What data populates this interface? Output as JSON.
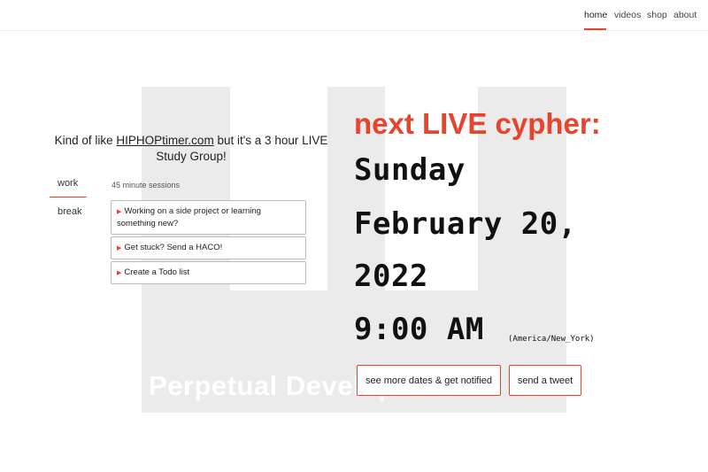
{
  "nav": {
    "items": [
      {
        "label": "home",
        "active": true
      },
      {
        "label": "videos",
        "active": false
      },
      {
        "label": "shop",
        "active": false
      },
      {
        "label": "about",
        "active": false
      }
    ]
  },
  "background_logo": {
    "text": "Perpetual Development"
  },
  "tagline": {
    "prefix": "Kind of like ",
    "link": "HIPHOPtimer.com",
    "suffix": " but it's a 3 hour LIVE Study Group!"
  },
  "tabs": {
    "work": "work",
    "break": "break"
  },
  "sessions_label": "45 minute sessions",
  "list_items": [
    "Working on a side project or learning something new?",
    "Get stuck? Send a HACO!",
    "Create a Todo list"
  ],
  "cypher": {
    "heading": "next LIVE cypher:",
    "day": "Sunday",
    "date": "February 20,",
    "year": "2022",
    "time": "9:00 AM",
    "timezone": "(America/New_York)"
  },
  "buttons": {
    "more": "see more dates & get notified",
    "tweet": "send a tweet"
  },
  "colors": {
    "accent": "#e8432d",
    "logo_bg": "#ebebeb"
  }
}
